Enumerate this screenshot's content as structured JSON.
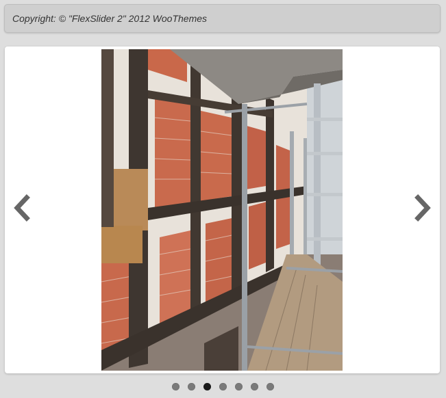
{
  "copyright": {
    "text": "Copyright: © \"FlexSlider 2\" 2012 WooThemes"
  },
  "slider": {
    "current_slide_index": 3,
    "total_slides": 7,
    "image_subject": "Half-timbered wall with red brick infill behind metal scaffolding",
    "prev_icon": "chevron-left-icon",
    "next_icon": "chevron-right-icon",
    "arrow_color": "#666666"
  },
  "control_nav": {
    "dots": [
      {
        "active": false
      },
      {
        "active": false
      },
      {
        "active": true
      },
      {
        "active": false
      },
      {
        "active": false
      },
      {
        "active": false
      },
      {
        "active": false
      }
    ],
    "active_color": "#1a1a1a",
    "inactive_color": "#7a7a7a"
  }
}
